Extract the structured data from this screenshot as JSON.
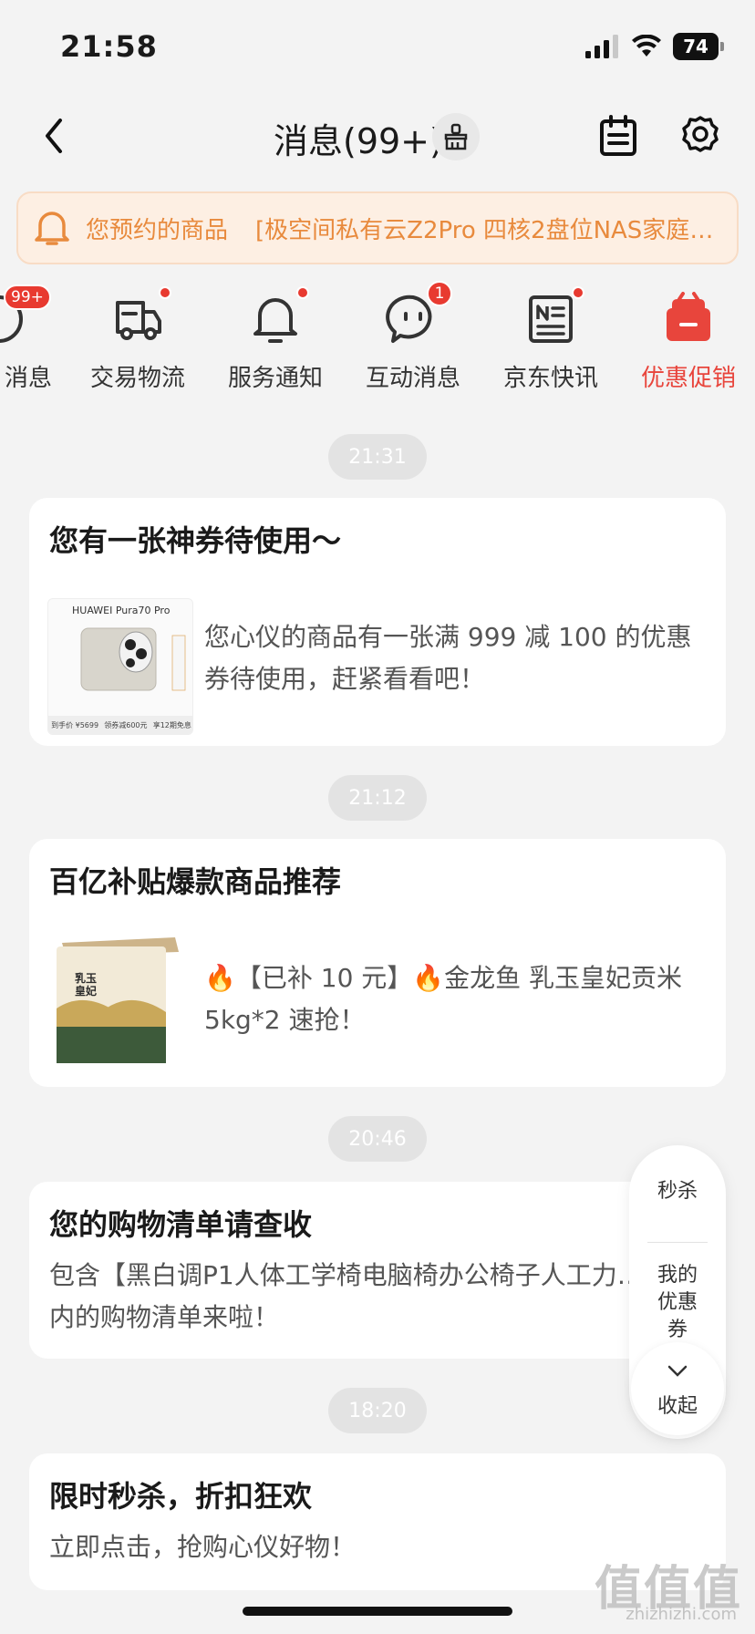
{
  "status": {
    "time": "21:58",
    "battery": "74"
  },
  "nav": {
    "title": "消息(99+)"
  },
  "notice": {
    "label": "您预约的商品",
    "item": "[极空间私有云Z2Pro 四核2盘位NAS家庭个…"
  },
  "categories": [
    {
      "label": "消息",
      "badge": "99+"
    },
    {
      "label": "交易物流"
    },
    {
      "label": "服务通知"
    },
    {
      "label": "互动消息",
      "badge": "1"
    },
    {
      "label": "京东快讯"
    },
    {
      "label": "优惠促销",
      "active": true
    }
  ],
  "colors": {
    "accent": "#e83a30",
    "notice_text": "#e88a3d",
    "active_tab": "#e8453c"
  },
  "messages": [
    {
      "time": "21:31",
      "title": "您有一张神券待使用～",
      "body": "您心仪的商品有一张满 999 减 100 的优惠券待使用，赶紧看看吧！",
      "thumb": {
        "brand": "HUAWEI Pura70 Pro",
        "price": "到手价 ¥5699",
        "tag1": "领券减600元",
        "tag2": "享12期免息"
      }
    },
    {
      "time": "21:12",
      "title": "百亿补贴爆款商品推荐",
      "body": "🔥【已补 10 元】🔥金龙鱼 乳玉皇妃贡米 5kg*2 速抢！",
      "thumb": {
        "product": "乳玉皇妃"
      }
    },
    {
      "time": "20:46",
      "title": "您的购物清单请查收",
      "body": "包含【黑白调P1人体工学椅电脑椅办公椅子人工力…在内的购物清单来啦！"
    },
    {
      "time": "18:20",
      "title": "限时秒杀，折扣狂欢",
      "body": "立即点击，抢购心仪好物！"
    }
  ],
  "float_panel": {
    "seckill": "秒杀",
    "coupon": "我的优惠券",
    "collapse": "收起"
  },
  "watermark": {
    "main": "值值值",
    "sub": "zhizhizhi.com"
  }
}
